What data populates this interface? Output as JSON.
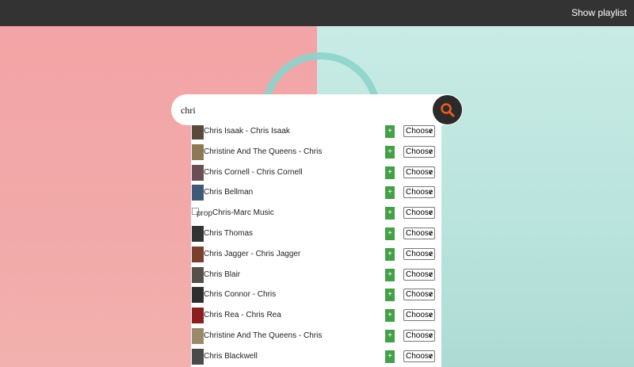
{
  "header": {
    "show_playlist": "Show playlist"
  },
  "search": {
    "value": "chri"
  },
  "results": [
    {
      "label": "Chris Isaak - Chris Isaak",
      "thumb": "#5b4a3c",
      "broken": false
    },
    {
      "label": "Christine And The Queens - Chris",
      "thumb": "#8d7a55",
      "broken": false
    },
    {
      "label": "Chris Cornell - Chris Cornell",
      "thumb": "#6a4e55",
      "broken": false
    },
    {
      "label": "Chris Bellman",
      "thumb": "#3f5a78",
      "broken": false
    },
    {
      "label": "Chris-Marc Music",
      "thumb": "",
      "broken": true,
      "alt": "prop"
    },
    {
      "label": "Chris Thomas",
      "thumb": "#333333",
      "broken": false
    },
    {
      "label": "Chris Jagger - Chris Jagger",
      "thumb": "#7a3f2d",
      "broken": false
    },
    {
      "label": "Chris Blair",
      "thumb": "#55504a",
      "broken": false
    },
    {
      "label": "Chris Connor - Chris",
      "thumb": "#2e2e2e",
      "broken": false
    },
    {
      "label": "Chris Rea - Chris Rea",
      "thumb": "#8b1e1e",
      "broken": false
    },
    {
      "label": "Christine And The Queens - Chris",
      "thumb": "#9a8a6a",
      "broken": false
    },
    {
      "label": "Chris Blackwell",
      "thumb": "#4a4a4a",
      "broken": false
    }
  ],
  "row_controls": {
    "add_label": "+",
    "choose_label": "Choose"
  }
}
